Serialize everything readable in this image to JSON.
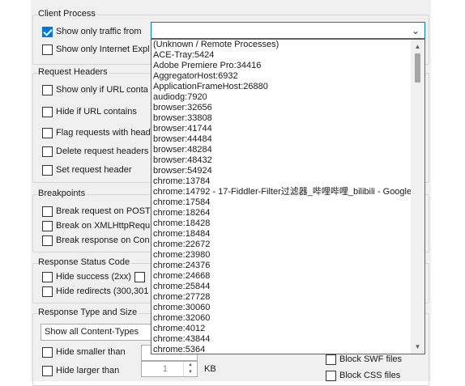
{
  "client_process": {
    "legend": "Client Process",
    "show_only_traffic_from": "Show only traffic from",
    "show_only_ie": "Show only Internet Expl",
    "dropdown_items": [
      "(Unknown / Remote Processes)",
      "ACE-Tray:5424",
      "Adobe Premiere Pro:34416",
      "AggregatorHost:6932",
      "ApplicationFrameHost:26880",
      "audiodg:7920",
      "browser:32656",
      "browser:33808",
      "browser:41744",
      "browser:44484",
      "browser:48284",
      "browser:48432",
      "browser:54924",
      "chrome:13784",
      "chrome:14792 - 17-Fiddler-Filter过滤器_哔哩哔哩_bilibili - Google",
      "chrome:17584",
      "chrome:18264",
      "chrome:18428",
      "chrome:18484",
      "chrome:22672",
      "chrome:23980",
      "chrome:24376",
      "chrome:24668",
      "chrome:25844",
      "chrome:27728",
      "chrome:30060",
      "chrome:32060",
      "chrome:4012",
      "chrome:43844",
      "chrome:5364"
    ]
  },
  "request_headers": {
    "legend": "Request Headers",
    "show_only_if_url": "Show only if URL conta",
    "hide_if_url": "Hide if URL contains",
    "flag_requests": "Flag requests with head",
    "delete_request_headers": "Delete request headers",
    "set_request_header": "Set request header"
  },
  "breakpoints": {
    "legend": "Breakpoints",
    "break_post": "Break request on POST",
    "break_xhr": "Break on XMLHttpRequ",
    "break_response": "Break response on Con"
  },
  "response_status": {
    "legend": "Response Status Code",
    "hide_success": "Hide success (2xx)",
    "hide_redirects": "Hide redirects (300,301"
  },
  "response_type": {
    "legend": "Response Type and Size",
    "content_type_selected": "Show all Content-Types",
    "hide_smaller": "Hide smaller than",
    "hide_larger": "Hide larger than",
    "larger_value": "1",
    "kb_unit": "KB",
    "block_swf": "Block SWF files",
    "block_css": "Block CSS files"
  },
  "colors": {
    "accent": "#0078d7",
    "panel_bg": "#f0f0f0",
    "group_border": "#d6d6d6"
  }
}
